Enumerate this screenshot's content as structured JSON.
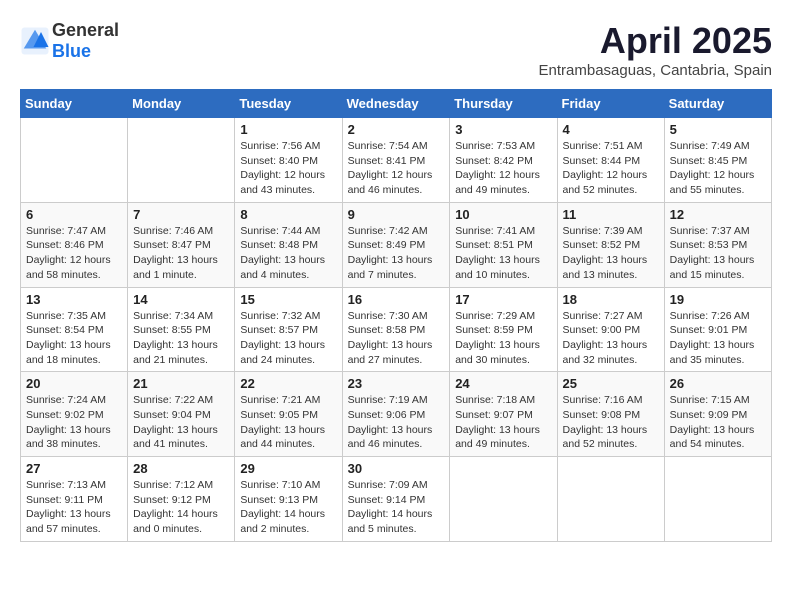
{
  "header": {
    "logo_general": "General",
    "logo_blue": "Blue",
    "title": "April 2025",
    "subtitle": "Entrambasaguas, Cantabria, Spain"
  },
  "weekdays": [
    "Sunday",
    "Monday",
    "Tuesday",
    "Wednesday",
    "Thursday",
    "Friday",
    "Saturday"
  ],
  "weeks": [
    [
      {
        "day": "",
        "info": ""
      },
      {
        "day": "",
        "info": ""
      },
      {
        "day": "1",
        "info": "Sunrise: 7:56 AM\nSunset: 8:40 PM\nDaylight: 12 hours and 43 minutes."
      },
      {
        "day": "2",
        "info": "Sunrise: 7:54 AM\nSunset: 8:41 PM\nDaylight: 12 hours and 46 minutes."
      },
      {
        "day": "3",
        "info": "Sunrise: 7:53 AM\nSunset: 8:42 PM\nDaylight: 12 hours and 49 minutes."
      },
      {
        "day": "4",
        "info": "Sunrise: 7:51 AM\nSunset: 8:44 PM\nDaylight: 12 hours and 52 minutes."
      },
      {
        "day": "5",
        "info": "Sunrise: 7:49 AM\nSunset: 8:45 PM\nDaylight: 12 hours and 55 minutes."
      }
    ],
    [
      {
        "day": "6",
        "info": "Sunrise: 7:47 AM\nSunset: 8:46 PM\nDaylight: 12 hours and 58 minutes."
      },
      {
        "day": "7",
        "info": "Sunrise: 7:46 AM\nSunset: 8:47 PM\nDaylight: 13 hours and 1 minute."
      },
      {
        "day": "8",
        "info": "Sunrise: 7:44 AM\nSunset: 8:48 PM\nDaylight: 13 hours and 4 minutes."
      },
      {
        "day": "9",
        "info": "Sunrise: 7:42 AM\nSunset: 8:49 PM\nDaylight: 13 hours and 7 minutes."
      },
      {
        "day": "10",
        "info": "Sunrise: 7:41 AM\nSunset: 8:51 PM\nDaylight: 13 hours and 10 minutes."
      },
      {
        "day": "11",
        "info": "Sunrise: 7:39 AM\nSunset: 8:52 PM\nDaylight: 13 hours and 13 minutes."
      },
      {
        "day": "12",
        "info": "Sunrise: 7:37 AM\nSunset: 8:53 PM\nDaylight: 13 hours and 15 minutes."
      }
    ],
    [
      {
        "day": "13",
        "info": "Sunrise: 7:35 AM\nSunset: 8:54 PM\nDaylight: 13 hours and 18 minutes."
      },
      {
        "day": "14",
        "info": "Sunrise: 7:34 AM\nSunset: 8:55 PM\nDaylight: 13 hours and 21 minutes."
      },
      {
        "day": "15",
        "info": "Sunrise: 7:32 AM\nSunset: 8:57 PM\nDaylight: 13 hours and 24 minutes."
      },
      {
        "day": "16",
        "info": "Sunrise: 7:30 AM\nSunset: 8:58 PM\nDaylight: 13 hours and 27 minutes."
      },
      {
        "day": "17",
        "info": "Sunrise: 7:29 AM\nSunset: 8:59 PM\nDaylight: 13 hours and 30 minutes."
      },
      {
        "day": "18",
        "info": "Sunrise: 7:27 AM\nSunset: 9:00 PM\nDaylight: 13 hours and 32 minutes."
      },
      {
        "day": "19",
        "info": "Sunrise: 7:26 AM\nSunset: 9:01 PM\nDaylight: 13 hours and 35 minutes."
      }
    ],
    [
      {
        "day": "20",
        "info": "Sunrise: 7:24 AM\nSunset: 9:02 PM\nDaylight: 13 hours and 38 minutes."
      },
      {
        "day": "21",
        "info": "Sunrise: 7:22 AM\nSunset: 9:04 PM\nDaylight: 13 hours and 41 minutes."
      },
      {
        "day": "22",
        "info": "Sunrise: 7:21 AM\nSunset: 9:05 PM\nDaylight: 13 hours and 44 minutes."
      },
      {
        "day": "23",
        "info": "Sunrise: 7:19 AM\nSunset: 9:06 PM\nDaylight: 13 hours and 46 minutes."
      },
      {
        "day": "24",
        "info": "Sunrise: 7:18 AM\nSunset: 9:07 PM\nDaylight: 13 hours and 49 minutes."
      },
      {
        "day": "25",
        "info": "Sunrise: 7:16 AM\nSunset: 9:08 PM\nDaylight: 13 hours and 52 minutes."
      },
      {
        "day": "26",
        "info": "Sunrise: 7:15 AM\nSunset: 9:09 PM\nDaylight: 13 hours and 54 minutes."
      }
    ],
    [
      {
        "day": "27",
        "info": "Sunrise: 7:13 AM\nSunset: 9:11 PM\nDaylight: 13 hours and 57 minutes."
      },
      {
        "day": "28",
        "info": "Sunrise: 7:12 AM\nSunset: 9:12 PM\nDaylight: 14 hours and 0 minutes."
      },
      {
        "day": "29",
        "info": "Sunrise: 7:10 AM\nSunset: 9:13 PM\nDaylight: 14 hours and 2 minutes."
      },
      {
        "day": "30",
        "info": "Sunrise: 7:09 AM\nSunset: 9:14 PM\nDaylight: 14 hours and 5 minutes."
      },
      {
        "day": "",
        "info": ""
      },
      {
        "day": "",
        "info": ""
      },
      {
        "day": "",
        "info": ""
      }
    ]
  ]
}
